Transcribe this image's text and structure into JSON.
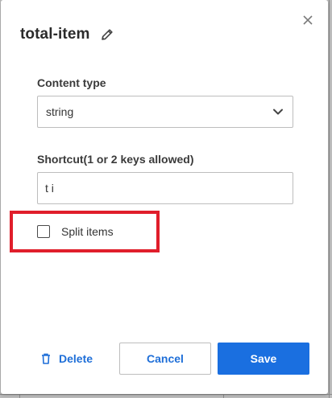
{
  "dialog": {
    "title": "total-item",
    "close_icon": "close-icon",
    "edit_icon": "pencil-icon"
  },
  "content_type": {
    "label": "Content type",
    "selected": "string",
    "icon": "chevron-down-icon"
  },
  "shortcut": {
    "label": "Shortcut(1 or 2 keys allowed)",
    "value": "t i"
  },
  "split_items": {
    "label": "Split items",
    "checked": false
  },
  "footer": {
    "delete_label": "Delete",
    "delete_icon": "trash-icon",
    "cancel_label": "Cancel",
    "save_label": "Save"
  },
  "colors": {
    "accent": "#1a6fe0",
    "highlight": "#e01e2b"
  }
}
